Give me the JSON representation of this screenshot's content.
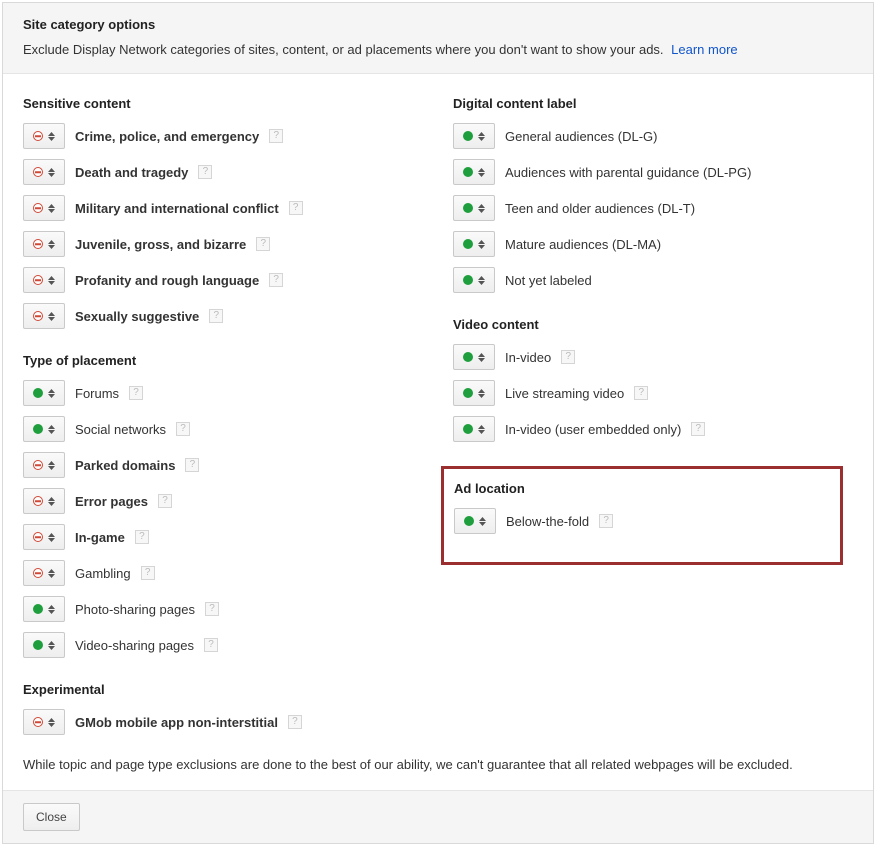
{
  "header": {
    "title": "Site category options",
    "subtitle": "Exclude Display Network categories of sites, content, or ad placements where you don't want to show your ads.",
    "learn_more": "Learn more"
  },
  "left": {
    "sensitive_heading": "Sensitive content",
    "sensitive": [
      {
        "label": "Crime, police, and emergency",
        "status": "excluded",
        "bold": true,
        "help": true
      },
      {
        "label": "Death and tragedy",
        "status": "excluded",
        "bold": true,
        "help": true
      },
      {
        "label": "Military and international conflict",
        "status": "excluded",
        "bold": true,
        "help": true
      },
      {
        "label": "Juvenile, gross, and bizarre",
        "status": "excluded",
        "bold": true,
        "help": true
      },
      {
        "label": "Profanity and rough language",
        "status": "excluded",
        "bold": true,
        "help": true
      },
      {
        "label": "Sexually suggestive",
        "status": "excluded",
        "bold": true,
        "help": true
      }
    ],
    "placement_heading": "Type of placement",
    "placement": [
      {
        "label": "Forums",
        "status": "included",
        "bold": false,
        "help": true
      },
      {
        "label": "Social networks",
        "status": "included",
        "bold": false,
        "help": true
      },
      {
        "label": "Parked domains",
        "status": "excluded",
        "bold": true,
        "help": true
      },
      {
        "label": "Error pages",
        "status": "excluded",
        "bold": true,
        "help": true
      },
      {
        "label": "In-game",
        "status": "excluded",
        "bold": true,
        "help": true
      },
      {
        "label": "Gambling",
        "status": "excluded",
        "bold": false,
        "help": true
      },
      {
        "label": "Photo-sharing pages",
        "status": "included",
        "bold": false,
        "help": true
      },
      {
        "label": "Video-sharing pages",
        "status": "included",
        "bold": false,
        "help": true
      }
    ],
    "experimental_heading": "Experimental",
    "experimental": [
      {
        "label": "GMob mobile app non-interstitial",
        "status": "excluded",
        "bold": true,
        "help": true
      }
    ]
  },
  "right": {
    "digital_heading": "Digital content label",
    "digital": [
      {
        "label": "General audiences (DL-G)",
        "status": "included",
        "bold": false,
        "help": false
      },
      {
        "label": "Audiences with parental guidance (DL-PG)",
        "status": "included",
        "bold": false,
        "help": false
      },
      {
        "label": "Teen and older audiences (DL-T)",
        "status": "included",
        "bold": false,
        "help": false
      },
      {
        "label": "Mature audiences (DL-MA)",
        "status": "included",
        "bold": false,
        "help": false
      },
      {
        "label": "Not yet labeled",
        "status": "included",
        "bold": false,
        "help": false
      }
    ],
    "video_heading": "Video content",
    "video": [
      {
        "label": "In-video",
        "status": "included",
        "bold": false,
        "help": true
      },
      {
        "label": "Live streaming video",
        "status": "included",
        "bold": false,
        "help": true
      },
      {
        "label": "In-video (user embedded only)",
        "status": "included",
        "bold": false,
        "help": true
      }
    ],
    "adloc_heading": "Ad location",
    "adloc": [
      {
        "label": "Below-the-fold",
        "status": "included",
        "bold": false,
        "help": true
      }
    ]
  },
  "note": "While topic and page type exclusions are done to the best of our ability, we can't guarantee that all related webpages will be excluded.",
  "footer": {
    "close": "Close"
  }
}
